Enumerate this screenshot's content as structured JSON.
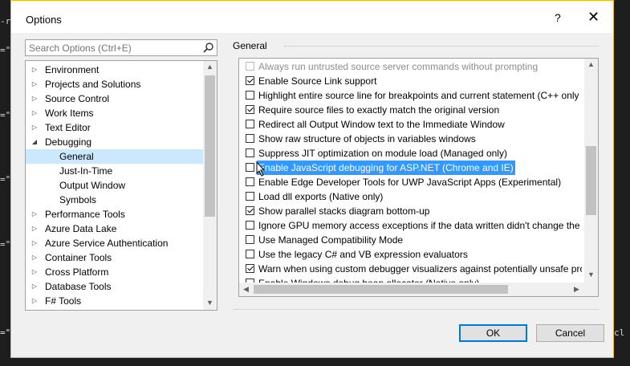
{
  "window": {
    "title": "Options",
    "help_label": "?",
    "close_label": "✕"
  },
  "search": {
    "placeholder": "Search Options (Ctrl+E)"
  },
  "tree": {
    "items": [
      {
        "label": "Environment",
        "expander": "collapsed",
        "selected": false
      },
      {
        "label": "Projects and Solutions",
        "expander": "collapsed",
        "selected": false
      },
      {
        "label": "Source Control",
        "expander": "collapsed",
        "selected": false
      },
      {
        "label": "Work Items",
        "expander": "collapsed",
        "selected": false
      },
      {
        "label": "Text Editor",
        "expander": "collapsed",
        "selected": false
      },
      {
        "label": "Debugging",
        "expander": "expanded",
        "selected": false
      },
      {
        "label": "General",
        "expander": "child",
        "selected": true
      },
      {
        "label": "Just-In-Time",
        "expander": "child",
        "selected": false
      },
      {
        "label": "Output Window",
        "expander": "child",
        "selected": false
      },
      {
        "label": "Symbols",
        "expander": "child",
        "selected": false
      },
      {
        "label": "Performance Tools",
        "expander": "collapsed",
        "selected": false
      },
      {
        "label": "Azure Data Lake",
        "expander": "collapsed",
        "selected": false
      },
      {
        "label": "Azure Service Authentication",
        "expander": "collapsed",
        "selected": false
      },
      {
        "label": "Container Tools",
        "expander": "collapsed",
        "selected": false
      },
      {
        "label": "Cross Platform",
        "expander": "collapsed",
        "selected": false
      },
      {
        "label": "Database Tools",
        "expander": "collapsed",
        "selected": false
      },
      {
        "label": "F# Tools",
        "expander": "collapsed",
        "selected": false
      }
    ]
  },
  "section": {
    "title": "General"
  },
  "options": [
    {
      "label": "Always run untrusted source server commands without prompting",
      "checked": false,
      "disabled": true,
      "selected": false
    },
    {
      "label": "Enable Source Link support",
      "checked": true,
      "disabled": false,
      "selected": false
    },
    {
      "label": "Highlight entire source line for breakpoints and current statement (C++ only",
      "checked": false,
      "disabled": false,
      "selected": false
    },
    {
      "label": "Require source files to exactly match the original version",
      "checked": true,
      "disabled": false,
      "selected": false
    },
    {
      "label": "Redirect all Output Window text to the Immediate Window",
      "checked": false,
      "disabled": false,
      "selected": false
    },
    {
      "label": "Show raw structure of objects in variables windows",
      "checked": false,
      "disabled": false,
      "selected": false
    },
    {
      "label": "Suppress JIT optimization on module load (Managed only)",
      "checked": false,
      "disabled": false,
      "selected": false
    },
    {
      "label": "Enable JavaScript debugging for ASP.NET (Chrome and IE)",
      "checked": false,
      "disabled": false,
      "selected": true
    },
    {
      "label": "Enable Edge Developer Tools for UWP JavaScript Apps (Experimental)",
      "checked": false,
      "disabled": false,
      "selected": false
    },
    {
      "label": "Load dll exports (Native only)",
      "checked": false,
      "disabled": false,
      "selected": false
    },
    {
      "label": "Show parallel stacks diagram bottom-up",
      "checked": true,
      "disabled": false,
      "selected": false
    },
    {
      "label": "Ignore GPU memory access exceptions if the data written didn't change the v",
      "checked": false,
      "disabled": false,
      "selected": false
    },
    {
      "label": "Use Managed Compatibility Mode",
      "checked": false,
      "disabled": false,
      "selected": false
    },
    {
      "label": "Use the legacy C# and VB expression evaluators",
      "checked": false,
      "disabled": false,
      "selected": false
    },
    {
      "label": "Warn when using custom debugger visualizers against potentially unsafe pro",
      "checked": true,
      "disabled": false,
      "selected": false
    },
    {
      "label": "Enable Windows debug heap allocator (Native only)",
      "checked": false,
      "disabled": false,
      "selected": false
    }
  ],
  "buttons": {
    "ok": "OK",
    "cancel": "Cancel"
  },
  "background": {
    "left_fragments": [
      "-rig",
      "=\"@",
      "=\"@",
      "=\"@",
      "=\"@",
      "=\"@",
      "=\"ma"
    ],
    "right_fragment": "cl"
  }
}
